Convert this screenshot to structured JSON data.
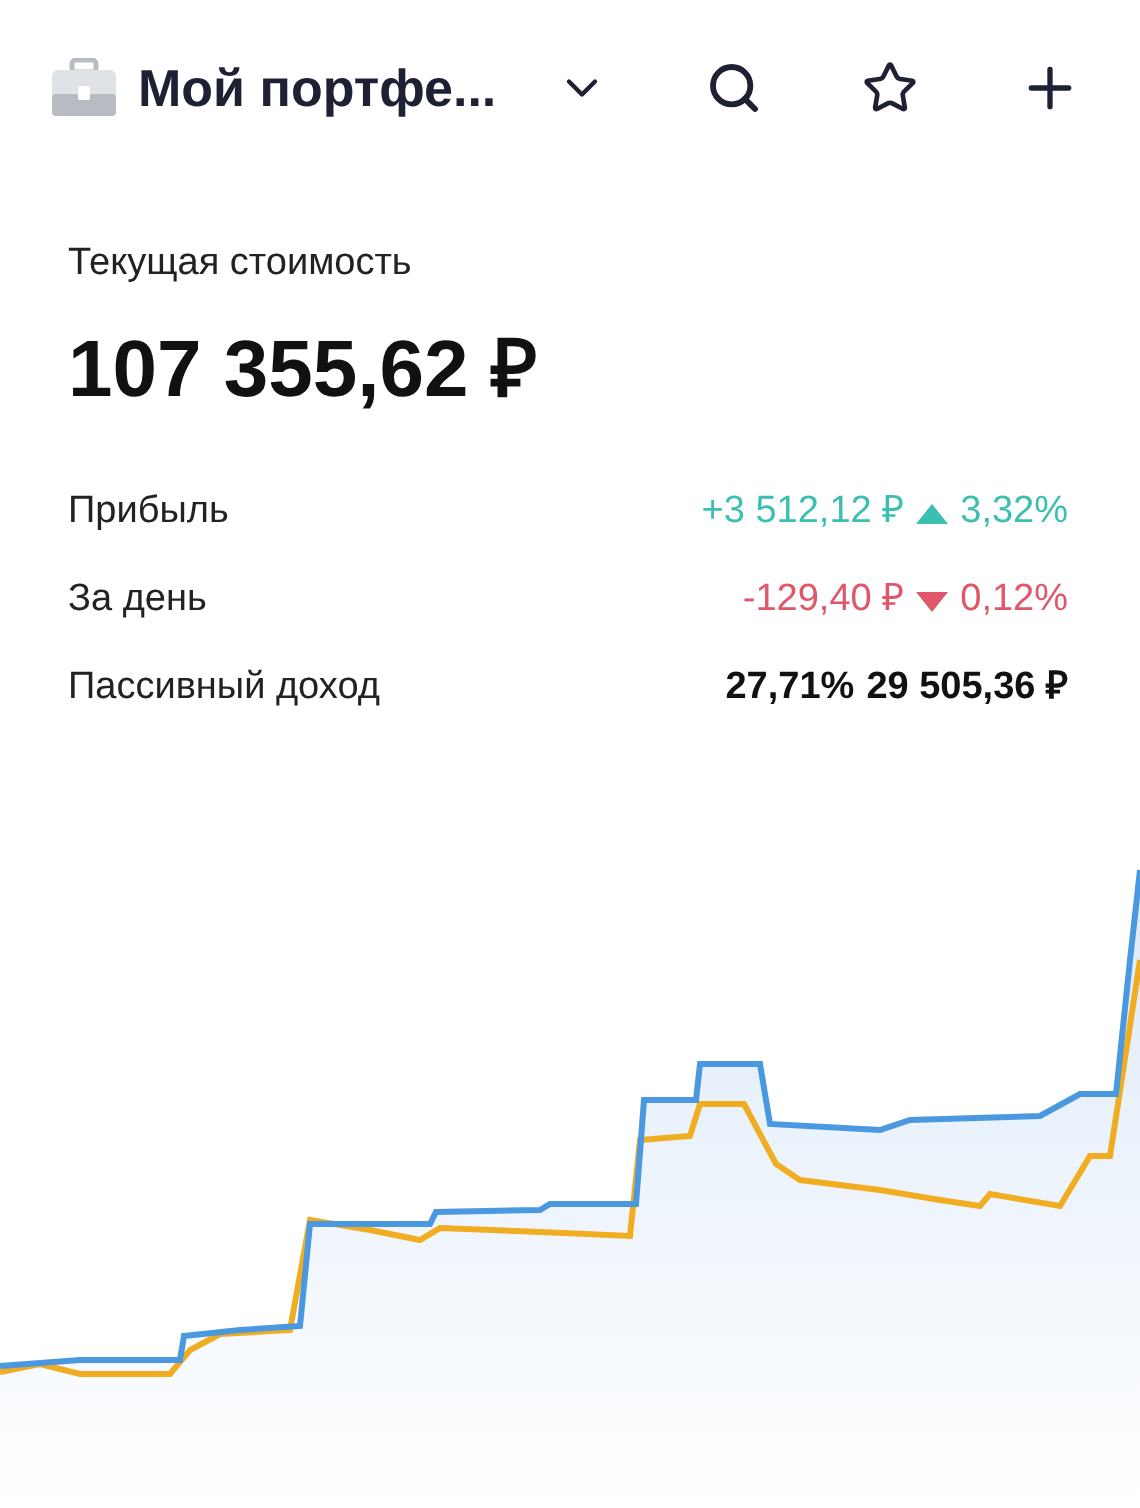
{
  "header": {
    "title": "Мой портфе..."
  },
  "summary": {
    "label": "Текущая стоимость",
    "value": "107 355,62 ₽"
  },
  "stats": [
    {
      "label": "Прибыль",
      "kind": "up",
      "amount": "+3 512,12 ₽",
      "percent": "3,32%"
    },
    {
      "label": "За день",
      "kind": "down",
      "amount": "-129,40 ₽",
      "percent": "0,12%"
    },
    {
      "label": "Пассивный доход",
      "kind": "plain",
      "amount": "27,71%",
      "percent": "29 505,36 ₽"
    }
  ]
}
